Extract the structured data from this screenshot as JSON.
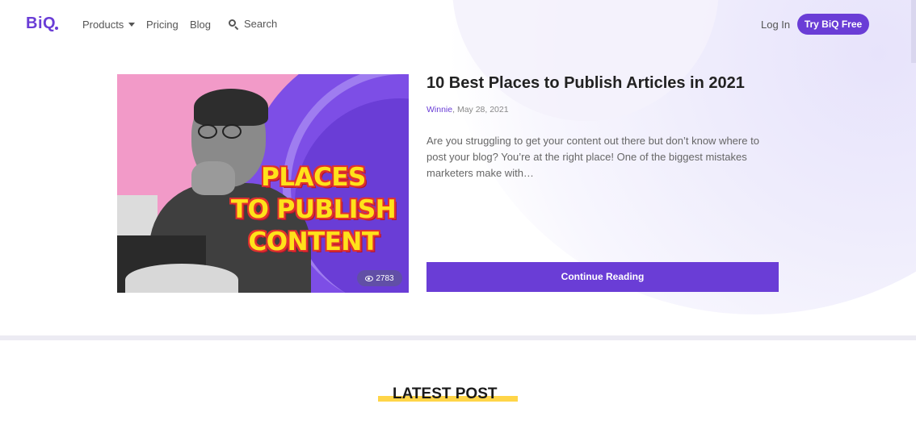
{
  "nav": {
    "logo": "BiQ",
    "products": "Products",
    "pricing": "Pricing",
    "blog": "Blog",
    "search": "Search",
    "login": "Log In",
    "cta": "Try BiQ Free"
  },
  "featured": {
    "image_text": [
      "PLACES",
      "TO PUBLISH",
      "CONTENT"
    ],
    "views": "2783",
    "title": "10 Best Places to Publish Articles in 2021",
    "author": "Winnie",
    "date": ", May 28, 2021",
    "excerpt": "Are you struggling to get your content out there but don’t know where to post your blog? You’re at the right place! One of the biggest mistakes marketers make with…",
    "button": "Continue Reading"
  },
  "latest": {
    "heading": "LATEST POST"
  },
  "colors": {
    "brand": "#6a3dd6",
    "accent_yellow": "#ffd548",
    "thumb_pink": "#f29ac8"
  },
  "icons": {
    "products_caret": "chevron-down-icon",
    "search": "search-icon",
    "views": "eye-icon"
  }
}
